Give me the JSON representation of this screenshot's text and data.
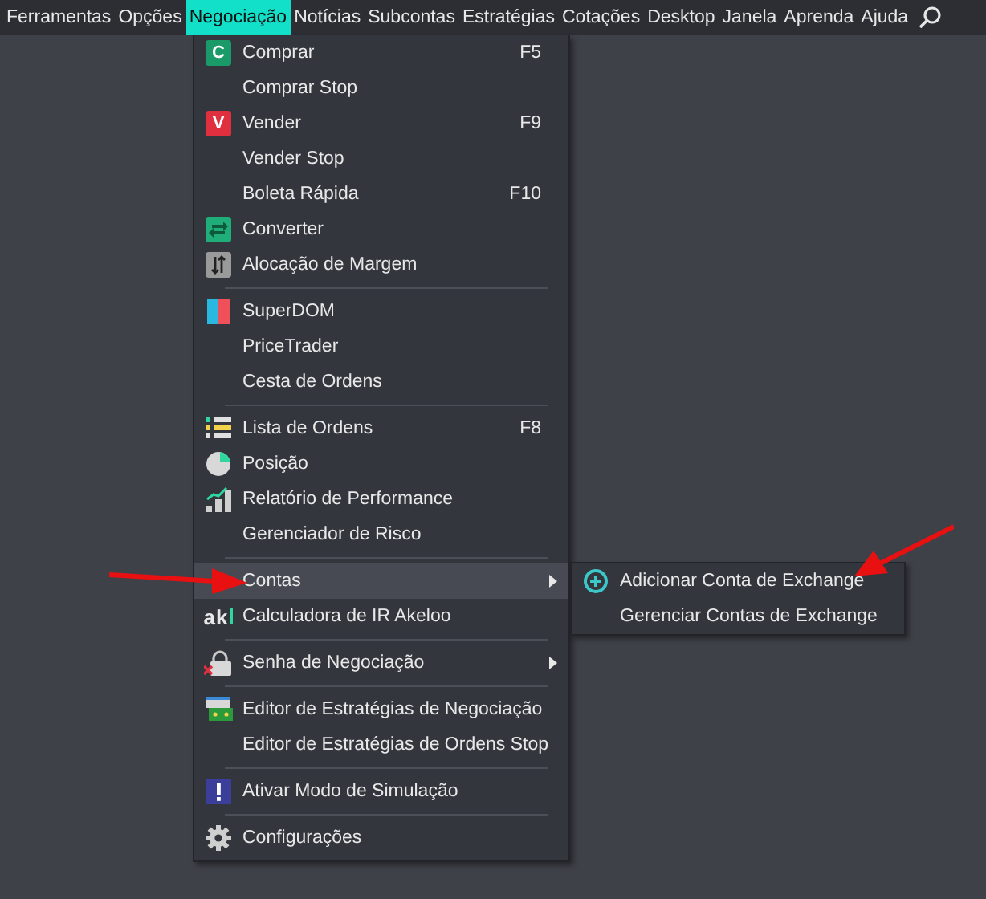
{
  "menubar": {
    "items": [
      {
        "label": "Ferramentas",
        "selected": false
      },
      {
        "label": "Opções",
        "selected": false
      },
      {
        "label": "Negociação",
        "selected": true
      },
      {
        "label": "Notícias",
        "selected": false
      },
      {
        "label": "Subcontas",
        "selected": false
      },
      {
        "label": "Estratégias",
        "selected": false
      },
      {
        "label": "Cotações",
        "selected": false
      },
      {
        "label": "Desktop",
        "selected": false
      },
      {
        "label": "Janela",
        "selected": false
      },
      {
        "label": "Aprenda",
        "selected": false
      },
      {
        "label": "Ajuda",
        "selected": false
      }
    ]
  },
  "menu": {
    "groups": [
      [
        {
          "label": "Comprar",
          "shortcut": "F5",
          "icon_text": "C",
          "selected": false,
          "has_submenu": false
        },
        {
          "label": "Comprar Stop",
          "selected": false,
          "has_submenu": false
        },
        {
          "label": "Vender",
          "shortcut": "F9",
          "icon_text": "V",
          "selected": false,
          "has_submenu": false
        },
        {
          "label": "Vender Stop",
          "selected": false,
          "has_submenu": false
        },
        {
          "label": "Boleta Rápida",
          "shortcut": "F10",
          "selected": false,
          "has_submenu": false
        },
        {
          "label": "Converter",
          "selected": false,
          "has_submenu": false
        },
        {
          "label": "Alocação de Margem",
          "selected": false,
          "has_submenu": false
        }
      ],
      [
        {
          "label": "SuperDOM",
          "selected": false,
          "has_submenu": false
        },
        {
          "label": "PriceTrader",
          "selected": false,
          "has_submenu": false
        },
        {
          "label": "Cesta de Ordens",
          "selected": false,
          "has_submenu": false
        }
      ],
      [
        {
          "label": "Lista de Ordens",
          "shortcut": "F8",
          "selected": false,
          "has_submenu": false
        },
        {
          "label": "Posição",
          "selected": false,
          "has_submenu": false
        },
        {
          "label": "Relatório de Performance",
          "selected": false,
          "has_submenu": false
        },
        {
          "label": "Gerenciador de Risco",
          "selected": false,
          "has_submenu": false
        }
      ],
      [
        {
          "label": "Contas",
          "selected": true,
          "has_submenu": true,
          "children": [
            {
              "label": "Adicionar Conta de Exchange",
              "selected": false
            },
            {
              "label": "Gerenciar Contas de Exchange",
              "selected": false
            }
          ]
        },
        {
          "label": "Calculadora de IR Akeloo",
          "icon_text": "ak",
          "selected": false,
          "has_submenu": false
        }
      ],
      [
        {
          "label": "Senha de Negociação",
          "selected": false,
          "has_submenu": true
        }
      ],
      [
        {
          "label": "Editor de Estratégias de Negociação",
          "selected": false,
          "has_submenu": false
        },
        {
          "label": "Editor de Estratégias de Ordens Stop",
          "selected": false,
          "has_submenu": false
        }
      ],
      [
        {
          "label": "Ativar Modo de Simulação",
          "selected": false,
          "has_submenu": false
        }
      ],
      [
        {
          "label": "Configurações",
          "selected": false,
          "has_submenu": false
        }
      ]
    ]
  },
  "annotations": [
    {
      "kind": "arrow"
    },
    {
      "kind": "arrow"
    }
  ]
}
